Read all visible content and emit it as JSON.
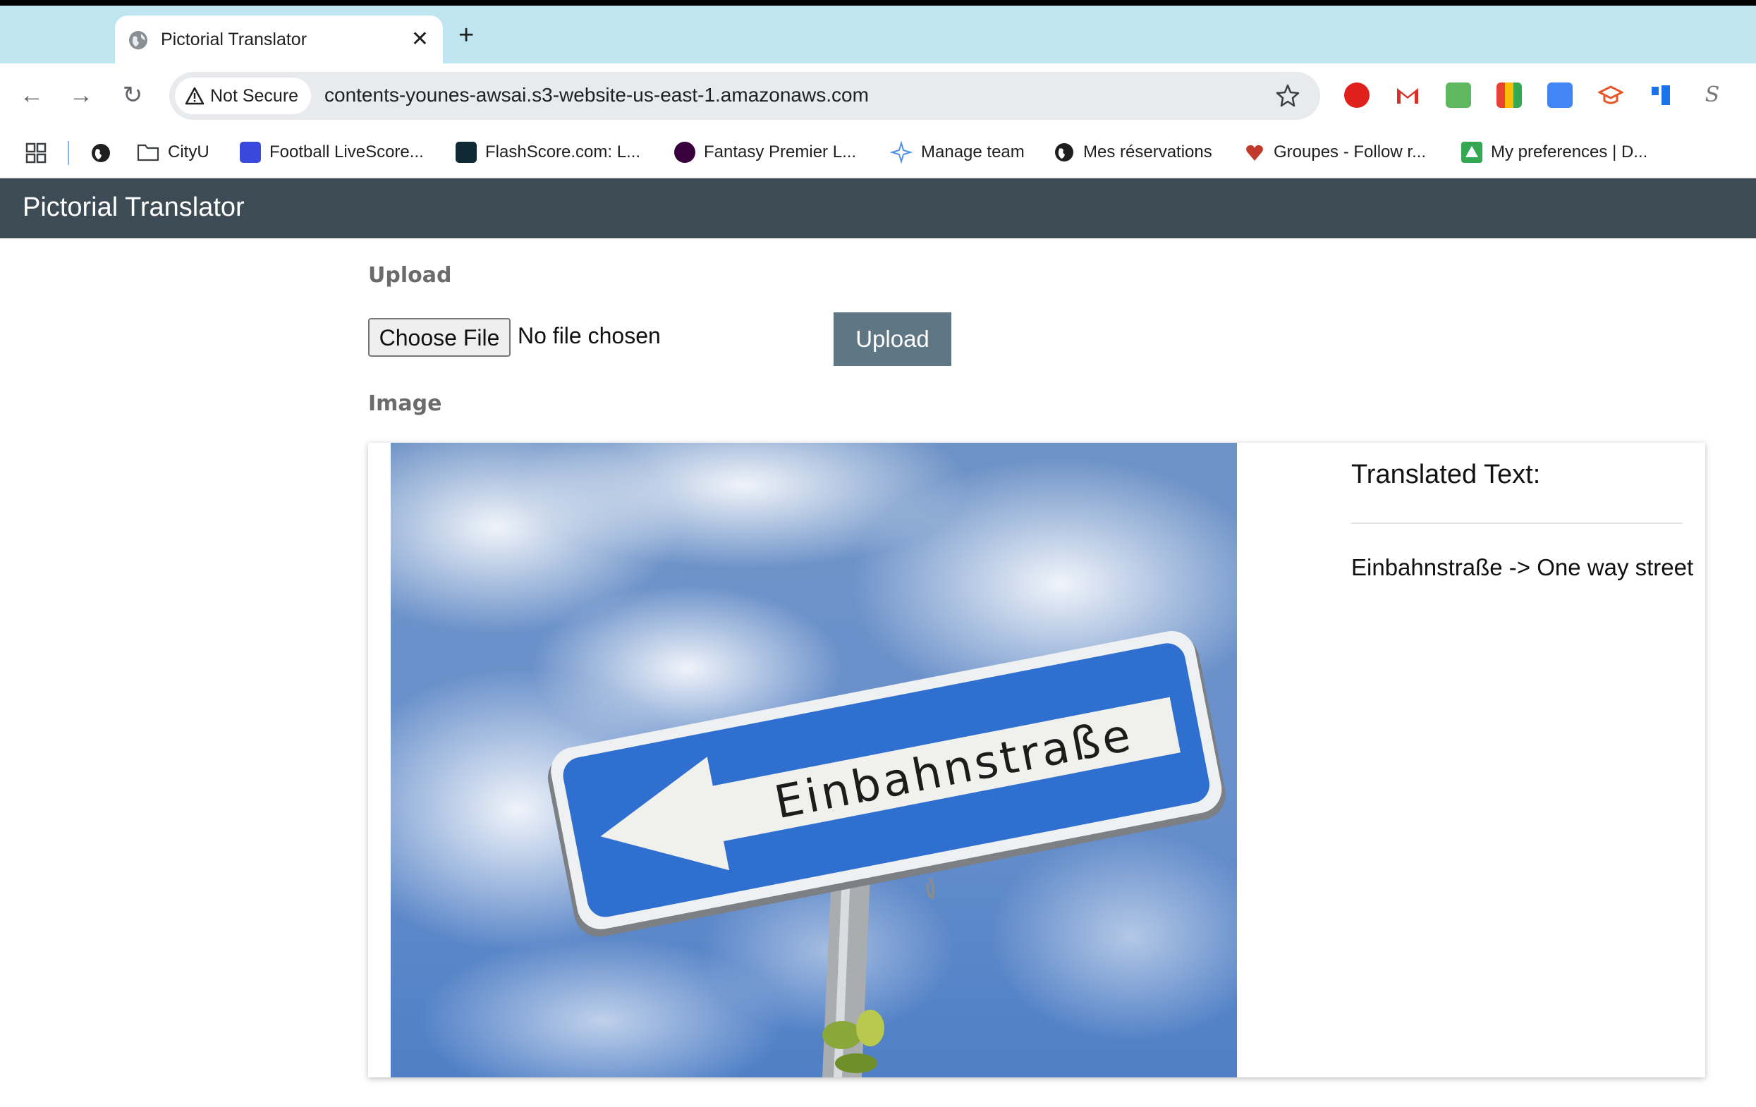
{
  "browser": {
    "tab_title": "Pictorial Translator",
    "tab_close_icon": "close-icon",
    "new_tab_icon": "plus-icon",
    "security_label": "Not Secure",
    "url": "contents-younes-awsai.s3-website-us-east-1.amazonaws.com",
    "bookmarks": [
      {
        "label": "CityU"
      },
      {
        "label": "Football LiveScore..."
      },
      {
        "label": "FlashScore.com: L..."
      },
      {
        "label": "Fantasy Premier L..."
      },
      {
        "label": "Manage team"
      },
      {
        "label": "Mes réservations"
      },
      {
        "label": "Groupes - Follow r..."
      },
      {
        "label": "My preferences | D..."
      }
    ]
  },
  "app": {
    "title": "Pictorial Translator",
    "upload_section_label": "Upload",
    "choose_file_label": "Choose File",
    "file_status": "No file chosen",
    "upload_button_label": "Upload",
    "image_section_label": "Image",
    "sign_text": "Einbahnstraße",
    "translated_title": "Translated Text:",
    "translated_text": "Einbahnstraße -> One way street"
  },
  "colors": {
    "app_bar": "#3d4c54",
    "upload_button": "#5f7785",
    "tab_strip": "#bfe6f0",
    "sign_blue": "#2f6fd0"
  }
}
